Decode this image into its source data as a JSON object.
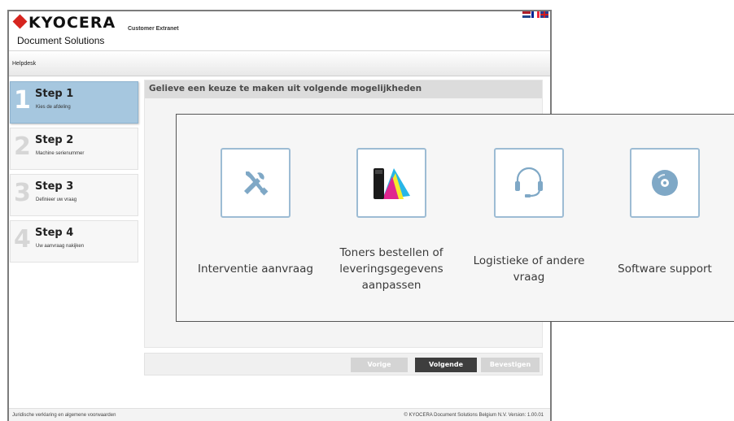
{
  "header": {
    "logo_word": "KYOCERA",
    "logo_sub": "Document Solutions",
    "extranet": "Customer Extranet"
  },
  "helpbar": {
    "link": "Helpdesk"
  },
  "steps": [
    {
      "num": "1",
      "title": "Step 1",
      "sub": "Kies de afdeling",
      "active": true
    },
    {
      "num": "2",
      "title": "Step 2",
      "sub": "Machine serienummer",
      "active": false
    },
    {
      "num": "3",
      "title": "Step 3",
      "sub": "Definieer uw vraag",
      "active": false
    },
    {
      "num": "4",
      "title": "Step 4",
      "sub": "Uw aanvraag nakijken",
      "active": false
    }
  ],
  "content": {
    "title": "Gelieve een keuze te maken uit volgende mogelijkheden"
  },
  "buttons": {
    "prev": "Vorige",
    "next": "Volgende",
    "confirm": "Bevestigen"
  },
  "footer": {
    "left": "Juridische verklaring en algemene voorwaarden",
    "right": "© KYOCERA Document Solutions Belgium N.V.   Version: 1.00.01"
  },
  "options": {
    "service": {
      "label": "Interventie aanvraag",
      "icon": "tools-icon"
    },
    "toners": {
      "line1": "Toners bestellen of",
      "line2": "leveringsgegevens",
      "line3": "aanpassen",
      "icon": "toner-icon"
    },
    "logistics": {
      "line1": "Logistieke of andere",
      "line2": "vraag",
      "icon": "headset-icon"
    },
    "software": {
      "label": "Software support",
      "icon": "disc-icon"
    }
  },
  "colors": {
    "brand_red": "#d6251f",
    "active_step": "#a6c7df",
    "tile_border": "#9dbcd4",
    "icon_blue": "#7fa8c6",
    "primary_button": "#3e3e3e",
    "disabled_button": "#d4d4d4"
  }
}
